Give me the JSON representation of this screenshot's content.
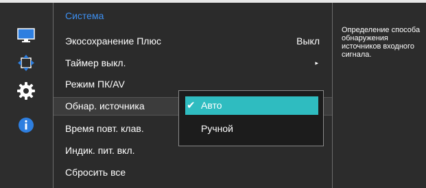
{
  "colors": {
    "accent_title": "#3d8ff0",
    "selection_highlight": "#2fbcc0",
    "background": "#2c2c2c",
    "text": "#ffffff"
  },
  "sidebar": {
    "icons": [
      {
        "name": "picture-monitor-icon"
      },
      {
        "name": "onscreen-display-icon"
      },
      {
        "name": "system-gear-icon"
      },
      {
        "name": "information-icon"
      }
    ]
  },
  "menu": {
    "title": "Система",
    "items": [
      {
        "label": "Экосохранение Плюс",
        "value": "Выкл"
      },
      {
        "label": "Таймер выкл.",
        "value": "▸"
      },
      {
        "label": "Режим ПК/AV",
        "value": ""
      },
      {
        "label": "Обнар. источника",
        "value": ""
      },
      {
        "label": "Время повт. клав.",
        "value": ""
      },
      {
        "label": "Индик. пит. вкл.",
        "value": ""
      },
      {
        "label": "Сбросить все",
        "value": ""
      }
    ]
  },
  "submenu": {
    "options": [
      {
        "label": "Авто",
        "check": "✔"
      },
      {
        "label": "Ручной",
        "check": ""
      }
    ]
  },
  "description": "Определение способа обнаружения источников входного сигнала."
}
